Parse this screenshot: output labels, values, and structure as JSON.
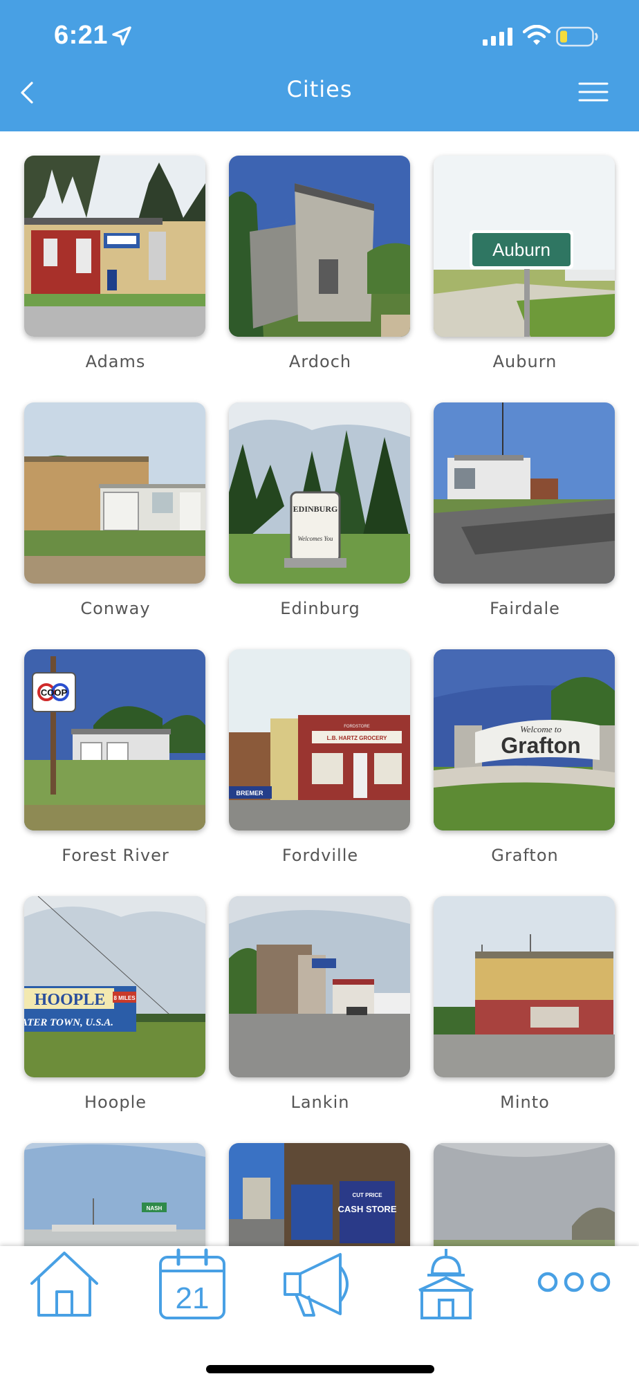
{
  "status_bar": {
    "time": "6:21",
    "icons": [
      "location-arrow-icon",
      "signal-bars-icon",
      "wifi-icon",
      "battery-low-icon"
    ]
  },
  "header": {
    "title": "Cities",
    "back_icon": "chevron-left-icon",
    "menu_icon": "hamburger-menu-icon",
    "background_color": "#48a0e4"
  },
  "cities": [
    {
      "name": "Adams"
    },
    {
      "name": "Ardoch"
    },
    {
      "name": "Auburn",
      "sign_text": "Auburn"
    },
    {
      "name": "Conway"
    },
    {
      "name": "Edinburg",
      "sign_text": "EDINBURG",
      "sign_subtext": "Welcomes You"
    },
    {
      "name": "Fairdale"
    },
    {
      "name": "Forest River",
      "sign_text": "COOP"
    },
    {
      "name": "Fordville",
      "sign_text": "L.B. HARTZ GROCERY",
      "sign_subtext": "FORDSTORE",
      "banner_text": "BREMER"
    },
    {
      "name": "Grafton",
      "sign_text": "Grafton",
      "sign_subtext": "Welcome to"
    },
    {
      "name": "Hoople",
      "sign_text": "HOOPLE",
      "sign_subtext": "ATER TOWN, U.S.A.",
      "badge_text": "8 MILES"
    },
    {
      "name": "Lankin"
    },
    {
      "name": "Minto"
    },
    {
      "name": "",
      "sign_text": "NASH"
    },
    {
      "name": "",
      "sign_text": "CUT PRICE",
      "sign_subtext": "CASH STORE"
    },
    {
      "name": ""
    }
  ],
  "tabbar": {
    "tabs": [
      {
        "icon": "home-icon"
      },
      {
        "icon": "calendar-icon",
        "label": "21"
      },
      {
        "icon": "megaphone-icon"
      },
      {
        "icon": "city-hall-icon"
      },
      {
        "icon": "more-dots-icon"
      }
    ],
    "accent_color": "#48a0e4"
  }
}
